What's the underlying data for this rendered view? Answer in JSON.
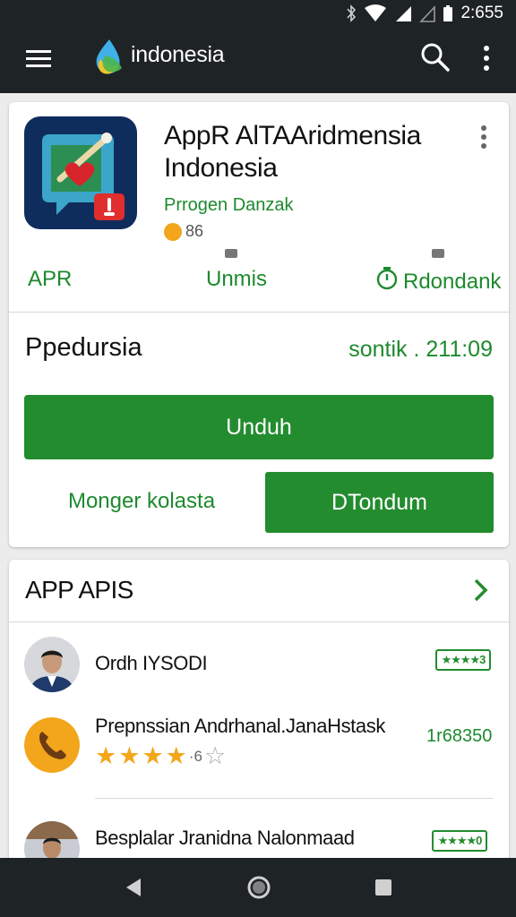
{
  "status_bar": {
    "time": "2:655"
  },
  "app_bar": {
    "brand": "indonesia"
  },
  "app": {
    "title": "AppR AlTAAridmensia",
    "title_line2": "Indonesia",
    "developer": "Prrogen Danzak",
    "rating_count": "86",
    "stats": [
      {
        "label": "APR"
      },
      {
        "label": "Unmis"
      },
      {
        "label": "Rdondank"
      }
    ],
    "section_label": "Ppedursia",
    "date_label": "sontik . 211:09",
    "primary_button": "Unduh",
    "text_button": "Monger kolasta",
    "secondary_button": "DTondum"
  },
  "list": {
    "header": "APP APIS",
    "rows": [
      {
        "title": "Ordh IYSODI",
        "badge": "★★★★3"
      },
      {
        "title": "Prepnssian Andrhanal.JanaHstask",
        "rating_text": "·6",
        "stars": 3.5,
        "count": "1r68350"
      },
      {
        "title": "Besplalar Jranidna Nalonmaad",
        "badge": "★★★★0"
      }
    ]
  },
  "colors": {
    "green": "#238c2f",
    "dark_bar": "#1e2326",
    "star": "#f2a71b"
  }
}
